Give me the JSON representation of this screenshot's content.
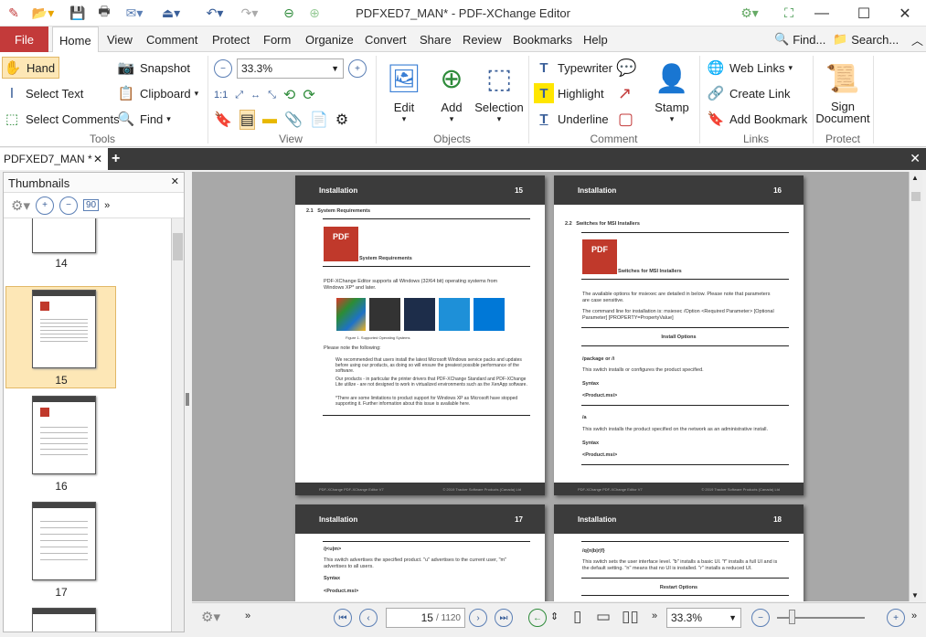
{
  "window": {
    "title": "PDFXED7_MAN* - PDF-XChange Editor"
  },
  "menu": {
    "file": "File",
    "tabs": [
      "Home",
      "View",
      "Comment",
      "Protect",
      "Form",
      "Organize",
      "Convert",
      "Share",
      "Review",
      "Bookmarks",
      "Help"
    ],
    "find": "Find...",
    "search": "Search..."
  },
  "ribbon": {
    "tools": {
      "hand": "Hand",
      "select_text": "Select Text",
      "select_comments": "Select Comments",
      "snapshot": "Snapshot",
      "clipboard": "Clipboard",
      "find": "Find",
      "group": "Tools"
    },
    "view": {
      "zoom": "33.3%",
      "group": "View"
    },
    "objects": {
      "edit": "Edit",
      "add": "Add",
      "selection": "Selection",
      "group": "Objects"
    },
    "comment": {
      "typewriter": "Typewriter",
      "highlight": "Highlight",
      "underline": "Underline",
      "stamp": "Stamp",
      "group": "Comment"
    },
    "links": {
      "web_links": "Web Links",
      "create_link": "Create Link",
      "add_bookmark": "Add Bookmark",
      "group": "Links"
    },
    "protect": {
      "sign": "Sign",
      "document": "Document",
      "group": "Protect"
    }
  },
  "doc_tab": {
    "label": "PDFXED7_MAN *"
  },
  "thumbnails": {
    "title": "Thumbnails",
    "rotate_label": "90",
    "pages": [
      "14",
      "15",
      "16",
      "17"
    ],
    "selected": "15"
  },
  "pages": [
    {
      "title": "Installation",
      "num": "15",
      "section": "2.1",
      "heading": "System Requirements",
      "pdf": "PDF",
      "subheading": "System Requirements",
      "body": "PDF-XChange Editor supports all Windows (32/64 bit) operating systems from Windows XP* and later.",
      "figure": "Figure 1. Supported Operating Systems",
      "note": "Please note the following:",
      "bullets": [
        "We recommended that users install the latest Microsoft Windows service packs and updates before using our products, as doing so will ensure the greatest possible performance of the software.",
        "Our products - in particular the printer drivers that PDF-XChange Standard and PDF-XChange Lite utilize - are not designed to work in virtualized environments such as the XenApp software.",
        "*There are some limitations to product support for Windows XP as Microsoft have stopped supporting it. Further information about this issue is available here."
      ],
      "footer_left": "PDF-XChange PDF-XChange Editor V7",
      "footer_right": "© 2019 Tracker Software Products (Canada) Ltd"
    },
    {
      "title": "Installation",
      "num": "16",
      "section": "2.2",
      "heading": "Switches for MSI Installers",
      "pdf": "PDF",
      "subheading": "Switches for MSI Installers",
      "body1": "The available options for msiexec are detailed in below. Please note that parameters are case sensitive.",
      "body2": "The command line for installation is: msiexec /Option <Required Parameter> [Optional Parameter] [PROPERTY=PropertyValue]",
      "table_title": "Install Options",
      "opt1": "/package or /i",
      "opt1_desc": "This switch installs or configures the product specified.",
      "syntax": "Syntax",
      "prod": "<Product.msi>",
      "opt2": "/a",
      "opt2_desc": "This switch installs the product specified on the network as an administrative install.",
      "footer_left": "PDF-XChange PDF-XChange Editor V7",
      "footer_right": "© 2019 Tracker Software Products (Canada) Ltd"
    },
    {
      "title": "Installation",
      "num": "17",
      "opt": "/j<u|m>",
      "desc": "This switch advertises the specified product. \"u\" advertises to the current user, \"m\" advertises to all users.",
      "syntax": "Syntax",
      "prod": "<Product.msi>"
    },
    {
      "title": "Installation",
      "num": "18",
      "opt": "/q{n|b|r|f}",
      "desc": "This switch sets the user interface level. \"b\" installs a basic UI. \"f\" installs a full UI and is the default setting. \"n\" means that no UI is installed. \"r\" installs a reduced UI.",
      "restart": "Restart Options"
    }
  ],
  "status": {
    "page_current": "15",
    "page_total": "/ 1120",
    "zoom": "33.3%"
  }
}
